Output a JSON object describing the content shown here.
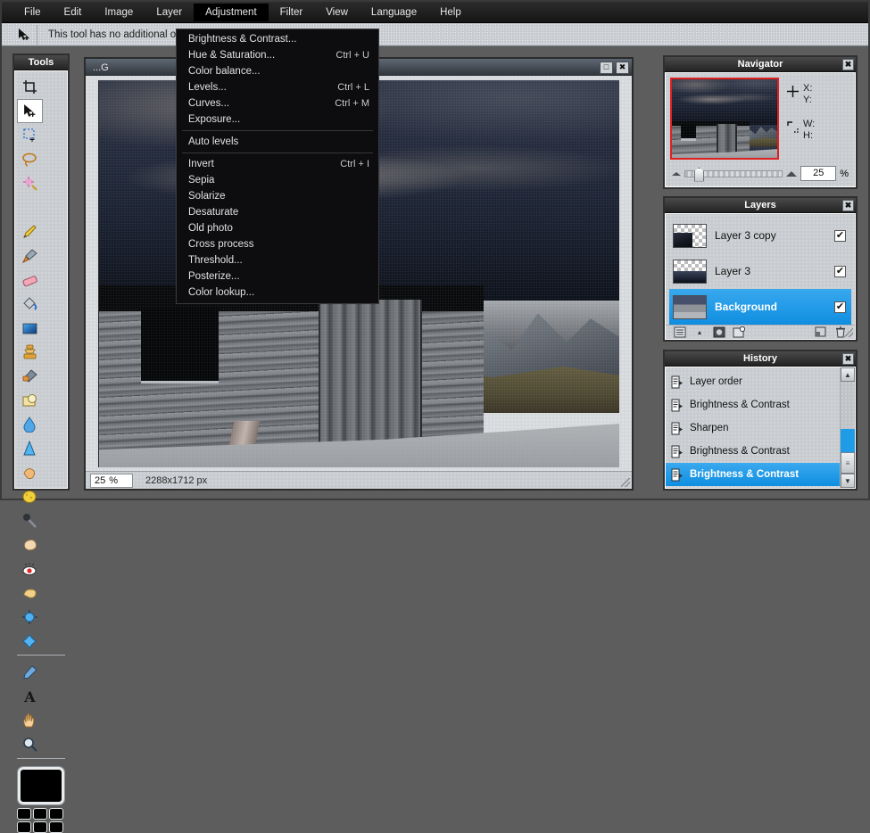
{
  "app": {
    "menubar": [
      {
        "label": "File",
        "active": false
      },
      {
        "label": "Edit",
        "active": false
      },
      {
        "label": "Image",
        "active": false
      },
      {
        "label": "Layer",
        "active": false
      },
      {
        "label": "Adjustment",
        "active": true
      },
      {
        "label": "Filter",
        "active": false
      },
      {
        "label": "View",
        "active": false
      },
      {
        "label": "Language",
        "active": false
      },
      {
        "label": "Help",
        "active": false
      }
    ],
    "options_bar": {
      "tool_icon": "move-tool-icon",
      "text": "This tool has no additional options"
    }
  },
  "dropdown": {
    "owner": "Adjustment",
    "items": [
      {
        "label": "Brightness & Contrast...",
        "shortcut": ""
      },
      {
        "label": "Hue & Saturation...",
        "shortcut": "Ctrl + U"
      },
      {
        "label": "Color balance...",
        "shortcut": ""
      },
      {
        "label": "Levels...",
        "shortcut": "Ctrl + L"
      },
      {
        "label": "Curves...",
        "shortcut": "Ctrl + M"
      },
      {
        "label": "Exposure...",
        "shortcut": ""
      },
      {
        "separator": true
      },
      {
        "label": "Auto levels",
        "shortcut": ""
      },
      {
        "separator": true
      },
      {
        "label": "Invert",
        "shortcut": "Ctrl + I"
      },
      {
        "label": "Sepia",
        "shortcut": ""
      },
      {
        "label": "Solarize",
        "shortcut": ""
      },
      {
        "label": "Desaturate",
        "shortcut": ""
      },
      {
        "label": "Old photo",
        "shortcut": ""
      },
      {
        "label": "Cross process",
        "shortcut": ""
      },
      {
        "label": "Threshold...",
        "shortcut": ""
      },
      {
        "label": "Posterize...",
        "shortcut": ""
      },
      {
        "label": "Color lookup...",
        "shortcut": ""
      }
    ]
  },
  "tools": {
    "title": "Tools",
    "close_label": "✖",
    "items": [
      {
        "name": "crop-tool-icon",
        "glyph": "⌗",
        "selected": false
      },
      {
        "name": "move-tool-icon",
        "glyph": "➤",
        "selected": true
      },
      {
        "name": "rectangular-marquee-tool-icon",
        "glyph": "⬚",
        "selected": false
      },
      {
        "name": "lasso-tool-icon",
        "glyph": "◯",
        "selected": false
      },
      {
        "name": "magic-wand-tool-icon",
        "glyph": "✦",
        "selected": false
      },
      {
        "name": "pencil-tool-icon",
        "glyph": "✏",
        "selected": false
      },
      {
        "name": "brush-tool-icon",
        "glyph": "🖌",
        "selected": false
      },
      {
        "name": "eraser-tool-icon",
        "glyph": "▰",
        "selected": false
      },
      {
        "name": "paint-bucket-tool-icon",
        "glyph": "⬡",
        "selected": false
      },
      {
        "name": "gradient-tool-icon",
        "glyph": "▤",
        "selected": false
      },
      {
        "name": "clone-stamp-tool-icon",
        "glyph": "⚒",
        "selected": false
      },
      {
        "name": "healing-brush-tool-icon",
        "glyph": "✐",
        "selected": false
      },
      {
        "name": "shapes-tool-icon",
        "glyph": "⬟",
        "selected": false
      },
      {
        "name": "blur-tool-icon",
        "glyph": "💧",
        "selected": false
      },
      {
        "name": "sharpen-tool-icon",
        "glyph": "▲",
        "selected": false
      },
      {
        "name": "smudge-tool-icon",
        "glyph": "👈",
        "selected": false
      },
      {
        "name": "sponge-tool-icon",
        "glyph": "⬤",
        "selected": false
      },
      {
        "name": "dodge-tool-icon",
        "glyph": "🔍",
        "selected": false
      },
      {
        "name": "burn-tool-icon",
        "glyph": "✋",
        "selected": false
      },
      {
        "name": "red-eye-tool-icon",
        "glyph": "👁",
        "selected": false
      },
      {
        "name": "bulge-tool-icon",
        "glyph": "☁",
        "selected": false
      },
      {
        "name": "pinch-tool-icon",
        "glyph": "◉",
        "selected": false
      },
      {
        "name": "warp-tool-icon",
        "glyph": "✸",
        "selected": false
      },
      {
        "name": "eyedropper-tool-icon",
        "glyph": "✒",
        "selected": false
      },
      {
        "name": "type-tool-icon",
        "glyph": "A",
        "selected": false
      },
      {
        "name": "hand-tool-icon",
        "glyph": "✋",
        "selected": false
      },
      {
        "name": "zoom-tool-icon",
        "glyph": "🔎",
        "selected": false
      }
    ],
    "foreground_color": "#000000",
    "palette_colors": [
      "#000000",
      "#000000",
      "#000000",
      "#000000",
      "#000000",
      "#000000"
    ]
  },
  "image_window": {
    "title": "...G",
    "maximize_label": "□",
    "close_label": "✖",
    "status": {
      "zoom": "25",
      "zoom_unit": "%",
      "dimensions": "2288x1712 px"
    }
  },
  "navigator": {
    "title": "Navigator",
    "close_label": "✖",
    "position_icon": "crosshair-icon",
    "size_icon": "selection-bounds-icon",
    "x_label": "X:",
    "y_label": "Y:",
    "w_label": "W:",
    "h_label": "H:",
    "x_value": "",
    "y_value": "",
    "w_value": "",
    "h_value": "",
    "zoom_value": "25",
    "zoom_unit": "%"
  },
  "layers": {
    "title": "Layers",
    "close_label": "✖",
    "rows": [
      {
        "name": "Layer 3 copy",
        "visible": true,
        "selected": false,
        "thumb": "partial"
      },
      {
        "name": "Layer 3",
        "visible": true,
        "selected": false,
        "thumb": "partial"
      },
      {
        "name": "Background",
        "visible": true,
        "selected": true,
        "thumb": "full"
      }
    ],
    "check_glyph": "✔",
    "toolbar": [
      {
        "name": "layer-properties-button",
        "glyph": "≡"
      },
      {
        "name": "layer-menu-chevron-icon",
        "glyph": "▴"
      },
      {
        "name": "layer-mask-button",
        "glyph": "◉"
      },
      {
        "name": "new-layer-button",
        "glyph": "❐"
      },
      {
        "name": "duplicate-layer-button",
        "glyph": "⧉"
      },
      {
        "name": "delete-layer-button",
        "glyph": "🗑"
      }
    ]
  },
  "history": {
    "title": "History",
    "close_label": "✖",
    "rows": [
      {
        "label": "Layer order",
        "selected": false
      },
      {
        "label": "Brightness & Contrast",
        "selected": false
      },
      {
        "label": "Sharpen",
        "selected": false
      },
      {
        "label": "Brightness & Contrast",
        "selected": false
      },
      {
        "label": "Brightness & Contrast",
        "selected": true
      }
    ],
    "scroll_up_glyph": "▲",
    "scroll_down_glyph": "▼",
    "scroll_thumb_glyph": "≡"
  },
  "colors": {
    "accent": "#0f8ee0",
    "panel_bg": "#c8ccd0",
    "titlebar": "#2b2b2b",
    "menu_bg": "#0d0d0f",
    "nav_crop_border": "#e02020"
  }
}
